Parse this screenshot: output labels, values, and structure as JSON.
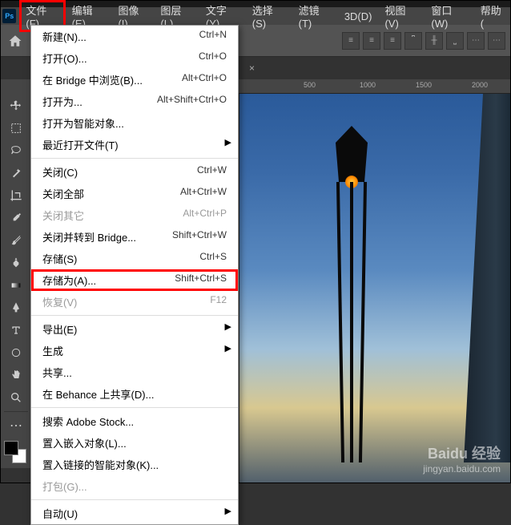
{
  "app_logo": "Ps",
  "menubar": {
    "file": "文件(F)",
    "edit": "编辑(E)",
    "image": "图像(I)",
    "layer": "图层(L)",
    "type": "文字(Y)",
    "select": "选择(S)",
    "filter": "滤镜(T)",
    "3d": "3D(D)",
    "view": "视图(V)",
    "window": "窗口(W)",
    "help": "帮助("
  },
  "ruler": {
    "m500": "500",
    "m1000": "1000",
    "m1500": "1500",
    "m2000": "2000"
  },
  "doc_tab_suffix": "×",
  "dropdown": {
    "new": {
      "label": "新建(N)...",
      "shortcut": "Ctrl+N"
    },
    "open": {
      "label": "打开(O)...",
      "shortcut": "Ctrl+O"
    },
    "browse_bridge": {
      "label": "在 Bridge 中浏览(B)...",
      "shortcut": "Alt+Ctrl+O"
    },
    "open_as": {
      "label": "打开为...",
      "shortcut": "Alt+Shift+Ctrl+O"
    },
    "open_smart": {
      "label": "打开为智能对象..."
    },
    "recent": {
      "label": "最近打开文件(T)"
    },
    "close": {
      "label": "关闭(C)",
      "shortcut": "Ctrl+W"
    },
    "close_all": {
      "label": "关闭全部",
      "shortcut": "Alt+Ctrl+W"
    },
    "close_other": {
      "label": "关闭其它",
      "shortcut": "Alt+Ctrl+P"
    },
    "close_bridge": {
      "label": "关闭并转到 Bridge...",
      "shortcut": "Shift+Ctrl+W"
    },
    "save": {
      "label": "存储(S)",
      "shortcut": "Ctrl+S"
    },
    "save_as": {
      "label": "存储为(A)...",
      "shortcut": "Shift+Ctrl+S"
    },
    "revert": {
      "label": "恢复(V)",
      "shortcut": "F12"
    },
    "export": {
      "label": "导出(E)"
    },
    "generate": {
      "label": "生成"
    },
    "share": {
      "label": "共享..."
    },
    "behance": {
      "label": "在 Behance 上共享(D)..."
    },
    "adobe_stock": {
      "label": "搜索 Adobe Stock..."
    },
    "place_embed": {
      "label": "置入嵌入对象(L)..."
    },
    "place_link": {
      "label": "置入链接的智能对象(K)..."
    },
    "package": {
      "label": "打包(G)..."
    },
    "automate": {
      "label": "自动(U)"
    }
  },
  "watermark": {
    "brand": "Baidu 经验",
    "url": "jingyan.baidu.com"
  }
}
